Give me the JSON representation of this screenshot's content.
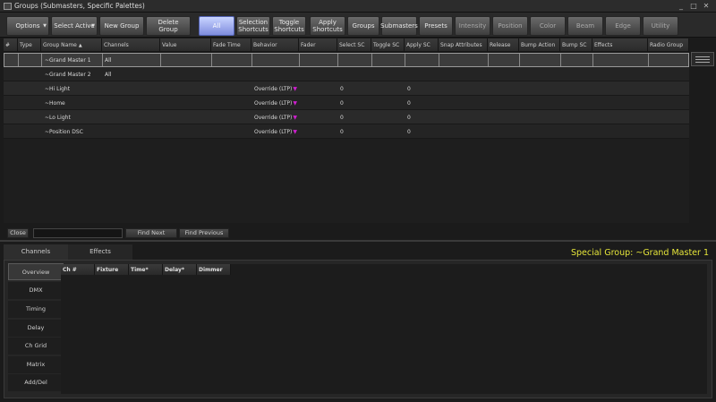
{
  "window": {
    "title": "Groups (Submasters, Specific Palettes)",
    "minimize": "_",
    "maximize": "□",
    "close": "✕"
  },
  "toolbar": [
    {
      "label": "Options",
      "name": "options-button",
      "dropdown": true
    },
    {
      "label": "Select Active",
      "name": "select-active-button",
      "dropdown": true
    },
    {
      "label": "New Group",
      "name": "new-group-button"
    },
    {
      "label": "Delete Group",
      "name": "delete-group-button"
    },
    {
      "label": "All",
      "name": "filter-all-button",
      "active": true
    },
    {
      "label": "Selection Shortcuts",
      "name": "selection-shortcuts-button"
    },
    {
      "label": "Toggle Shortcuts",
      "name": "toggle-shortcuts-button"
    },
    {
      "label": "Apply Shortcuts",
      "name": "apply-shortcuts-button"
    },
    {
      "label": "Groups",
      "name": "filter-groups-button"
    },
    {
      "label": "Submasters",
      "name": "filter-submasters-button"
    },
    {
      "label": "Presets",
      "name": "filter-presets-button"
    },
    {
      "label": "Intensity",
      "name": "filter-intensity-button",
      "dim": true
    },
    {
      "label": "Position",
      "name": "filter-position-button",
      "dim": true
    },
    {
      "label": "Color",
      "name": "filter-color-button",
      "dim": true
    },
    {
      "label": "Beam",
      "name": "filter-beam-button",
      "dim": true
    },
    {
      "label": "Edge",
      "name": "filter-edge-button",
      "dim": true
    },
    {
      "label": "Utility",
      "name": "filter-utility-button",
      "dim": true
    }
  ],
  "grid": {
    "columns": [
      "#",
      "Type",
      "Group Name",
      "Channels",
      "Value",
      "Fade Time",
      "Behavior",
      "Fader",
      "Select SC",
      "Toggle SC",
      "Apply SC",
      "Snap Attributes",
      "Release",
      "Bump Action",
      "Bump SC",
      "Effects",
      "Radio Group"
    ],
    "sort_indicator": "▲",
    "rows": [
      {
        "name": "~Grand Master 1",
        "channels": "All",
        "behavior": "",
        "select_sc": "",
        "apply_sc": "",
        "selected": true
      },
      {
        "name": "~Grand Master 2",
        "channels": "All",
        "behavior": "",
        "select_sc": "",
        "apply_sc": ""
      },
      {
        "name": "~Hi Light",
        "channels": "",
        "behavior": "Override (LTP)",
        "select_sc": "0",
        "apply_sc": "0"
      },
      {
        "name": "~Home",
        "channels": "",
        "behavior": "Override (LTP)",
        "select_sc": "0",
        "apply_sc": "0"
      },
      {
        "name": "~Lo Light",
        "channels": "",
        "behavior": "Override (LTP)",
        "select_sc": "0",
        "apply_sc": "0"
      },
      {
        "name": "~Position DSC",
        "channels": "",
        "behavior": "Override (LTP)",
        "select_sc": "0",
        "apply_sc": "0"
      }
    ],
    "dropdown_glyph": "▼"
  },
  "findbar": {
    "close": "Close",
    "find_next": "Find Next",
    "find_previous": "Find Previous",
    "query": ""
  },
  "lower": {
    "tabs": [
      "Channels",
      "Effects"
    ],
    "special_group": "Special Group: ~Grand Master 1",
    "side_buttons": [
      "Overview",
      "DMX",
      "Timing",
      "Delay",
      "Ch Grid",
      "Matrix",
      "Add/Del"
    ],
    "table_columns": [
      "Ch #",
      "Fixture",
      "Time*",
      "Delay*",
      "Dimmer"
    ]
  },
  "colors": {
    "accent_active": "#8f9cee",
    "special_text": "#e6e63a",
    "dropdown_marker": "#d01fd0"
  }
}
